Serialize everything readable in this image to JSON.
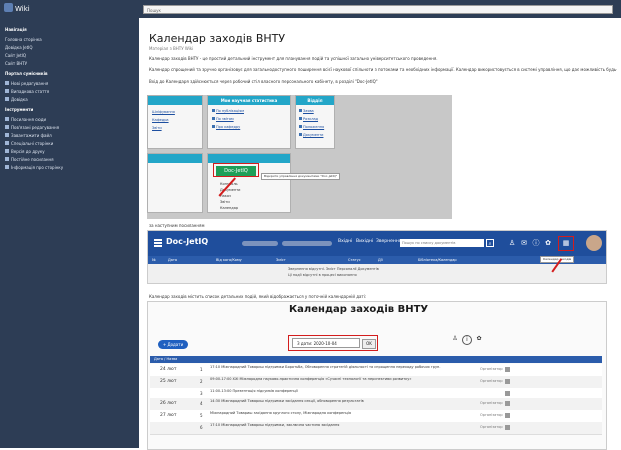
{
  "topbar": {
    "logo": "Wiki",
    "search_placeholder": "Пошук"
  },
  "sidebar": {
    "items": [
      {
        "label": "Навігація",
        "head": true
      },
      {
        "label": "Головна сторінка"
      },
      {
        "label": "Довідка JetIQ"
      },
      {
        "label": "Сайт JetIQ"
      },
      {
        "label": "Сайт ВНТУ"
      },
      {
        "label": "Портал сумісників",
        "head": true
      },
      {
        "label": "Нові редагування"
      },
      {
        "label": "Випадкова стаття"
      },
      {
        "label": "Довідка"
      },
      {
        "label": "Інструменти",
        "head": true
      },
      {
        "label": "Посилання сюди"
      },
      {
        "label": "Пов'язані редагування"
      },
      {
        "label": "Завантажити файл"
      },
      {
        "label": "Спеціальні сторінки"
      },
      {
        "label": "Версія до друку"
      },
      {
        "label": "Постійне посилання"
      },
      {
        "label": "Інформація про сторінку"
      }
    ]
  },
  "main": {
    "title": "Календар заходів ВНТУ",
    "crumb": "Матеріал з ВНТУ Wiki",
    "paragraphs": [
      "Календар заходів ВНТУ - це простий детальний інструмент для планування подій та успішної загально університетського проведення.",
      "Календар спрощений та зручно організовує для загальнодоступного поширення всієї наукової спільноти з потоками та необхідних інформації. Календар використовується в системі управління, що дає можливість будь-якому співробітнику додати свою подію.",
      "Вхід до Календаря здійснюється через робочий стіл власного персонального кабінету, в розділі \"Doc-JetIQ\""
    ],
    "caption_shot2": "за наступним посиланням",
    "caption_shot3": "Календар заходів містить список детальних подій, який відображається у поточній календарній даті:"
  },
  "shot1": {
    "panel_left_lines": [
      "Шліфування",
      "Кафедра",
      "Звіти"
    ],
    "panel_mid_title": "Мои научная статистика",
    "panel_mid_lines": [
      "По публікаціям",
      "По звітам",
      "Про кафедру"
    ],
    "panel_right_title": "Відділ",
    "panel_right_lines": [
      "Заява",
      "Розклад",
      "Положення",
      "Документи"
    ],
    "doc_button": "Doc-JetIQ",
    "doc_sub": [
      "Контроль",
      "Документи",
      "Наказ",
      "Звіти",
      "Календар"
    ],
    "tooltip": "Відкрити управління документами \"Doc-JetIQ\""
  },
  "shot2": {
    "title": "Doc-JetIQ",
    "tag1": "Вхідні",
    "tag2": "Вихідні",
    "tag3": "Звернення",
    "search_placeholder": "Пошук по списку документів",
    "columns": [
      "№",
      "Дата",
      "Від кого/Кому",
      "Зміст",
      "Статус",
      "Дії",
      "Бібліотека/Календар"
    ],
    "empty_line1": "Звернення відсутні. Зміст Персоналії Документів",
    "empty_line2": "Ці події відсутні в процесі виконання",
    "tooltip": "Календар заходів"
  },
  "shot3": {
    "title": "Календар заходів ВНТУ",
    "add_button": "+ Додати",
    "date_label": "З дати: 2020-10-04",
    "ok": "OK",
    "thead": "Дата / Назва",
    "rows": [
      {
        "date": "24 лют",
        "num": "1",
        "text": "17:10 Міжнародний Товариш підтримки Боротьба, Обговорення стратегій діяльності та спрощення переходу робочих груп.",
        "status": "Організатор"
      },
      {
        "date": "25 лют",
        "num": "2",
        "text": "09:00-17:00 XXI Міжнародна науково-практична конференція «Сучасні технології та перспективи розвитку»",
        "status": "Організатор"
      },
      {
        "date": "",
        "num": "3",
        "text": "11:00-13:00 Презентація підсумків конференції",
        "status": ""
      },
      {
        "date": "26 лют",
        "num": "4",
        "text": "14:30 Міжнародний Товариш підтримки засідання секції, обговорення результатів",
        "status": "Організатор"
      },
      {
        "date": "27 лют",
        "num": "5",
        "text": "Міжнародний Товариш засідання круглого столу, Міжнародна конференція",
        "status": "Організатор"
      },
      {
        "date": "",
        "num": "6",
        "text": "17:10 Міжнародний Товариш підтримки, заключна частина засідання",
        "status": "Організатор"
      }
    ]
  }
}
